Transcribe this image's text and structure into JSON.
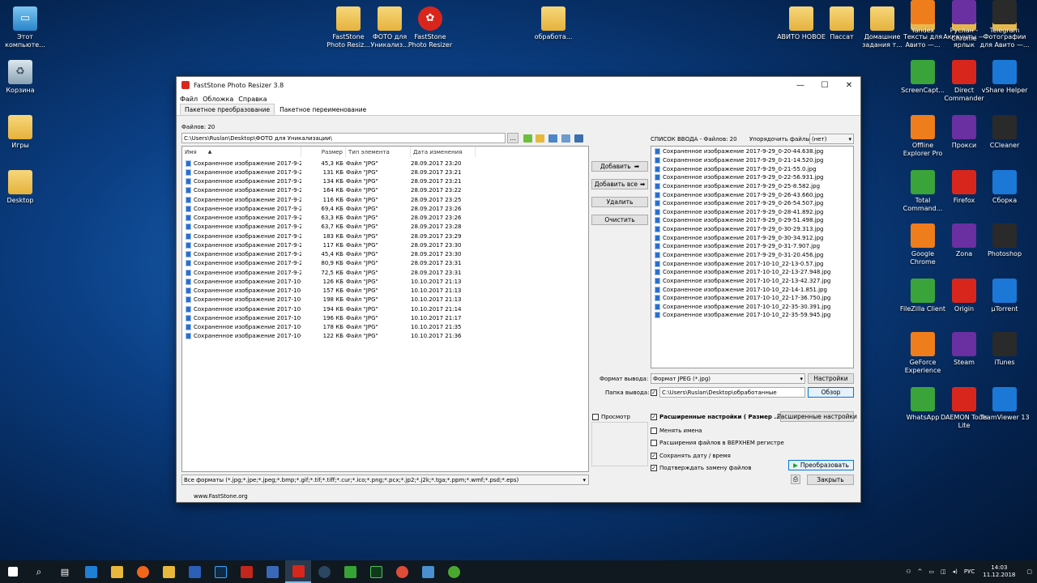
{
  "desktop": {
    "left_icons": [
      {
        "label": "Этот компьюте...",
        "icon": "computer-icon"
      },
      {
        "label": "Корзина",
        "icon": "recycle-bin-icon"
      },
      {
        "label": "Игры",
        "icon": "folder-icon"
      },
      {
        "label": "Desktop",
        "icon": "folder-icon"
      }
    ],
    "top_icons": [
      {
        "label": "FastStone Photo Resiz...",
        "icon": "folder-icon"
      },
      {
        "label": "ФОТО для Уникализ...",
        "icon": "folder-icon"
      },
      {
        "label": "FastStone Photo Resizer",
        "icon": "faststone-icon"
      },
      {
        "label": "обработа...",
        "icon": "folder-icon"
      }
    ],
    "right_icons": [
      {
        "label": "АВИТО НОВОЕ",
        "icon": "folder-icon"
      },
      {
        "label": "Пассат",
        "icon": "folder-icon"
      },
      {
        "label": "Домашние задания т...",
        "icon": "folder-icon"
      },
      {
        "label": "Тексты для Авито —...",
        "icon": "folder-icon"
      },
      {
        "label": "Аккаунты — ярлык",
        "icon": "folder-icon"
      },
      {
        "label": "Фотографии для Авито —...",
        "icon": "folder-icon"
      },
      {
        "label": "ScreenCapt...",
        "icon": "screencapture-icon"
      },
      {
        "label": "Direct Commander",
        "icon": "direct-commander-icon"
      },
      {
        "label": "vShare Helper",
        "icon": "vshare-icon"
      },
      {
        "label": "Offline Explorer Pro",
        "icon": "offline-explorer-icon"
      },
      {
        "label": "Прокси",
        "icon": "proxy-icon"
      },
      {
        "label": "CCleaner",
        "icon": "ccleaner-icon"
      },
      {
        "label": "Total Command...",
        "icon": "total-commander-icon"
      },
      {
        "label": "Firefox",
        "icon": "firefox-icon"
      },
      {
        "label": "Сборка",
        "icon": "winrar-icon"
      },
      {
        "label": "Google Chrome",
        "icon": "chrome-icon"
      },
      {
        "label": "Zona",
        "icon": "zona-icon"
      },
      {
        "label": "Photoshop",
        "icon": "photoshop-icon"
      },
      {
        "label": "FileZilla Client",
        "icon": "filezilla-icon"
      },
      {
        "label": "Origin",
        "icon": "origin-icon"
      },
      {
        "label": "µTorrent",
        "icon": "utorrent-icon"
      },
      {
        "label": "GeForce Experience",
        "icon": "geforce-icon"
      },
      {
        "label": "Steam",
        "icon": "steam-icon"
      },
      {
        "label": "iTunes",
        "icon": "itunes-icon"
      },
      {
        "label": "WhatsApp",
        "icon": "whatsapp-icon"
      },
      {
        "label": "DAEMON Tools Lite",
        "icon": "daemon-tools-icon"
      },
      {
        "label": "TeamViewer 13",
        "icon": "teamviewer-icon"
      },
      {
        "label": "Yandex",
        "icon": "yandex-icon"
      },
      {
        "label": "Руслан - Chrome",
        "icon": "chrome-icon"
      },
      {
        "label": "Telegram",
        "icon": "telegram-icon"
      }
    ]
  },
  "window": {
    "title": "FastStone Photo Resizer 3.8",
    "controls": {
      "minimize": "—",
      "maximize": "☐",
      "close": "✕"
    },
    "menu": [
      "Файл",
      "Обложка",
      "Справка"
    ],
    "tabs": [
      {
        "label": "Пакетное преобразование",
        "active": true
      },
      {
        "label": "Пакетное переименование",
        "active": false
      }
    ],
    "files_count": "Файлов: 20",
    "path": "C:\\Users\\Ruslan\\Desktop\\ФОТО для Уникализации\\",
    "path_browse": "...",
    "columns": {
      "name": "Имя",
      "size": "Размер",
      "type": "Тип элемента",
      "date": "Дата изменения"
    },
    "files": [
      {
        "name": "Сохраненное изображение 2017-9-2...",
        "size": "45,3 КБ",
        "type": "Файл \"JPG\"",
        "date": "28.09.2017 23:20"
      },
      {
        "name": "Сохраненное изображение 2017-9-2...",
        "size": "131 КБ",
        "type": "Файл \"JPG\"",
        "date": "28.09.2017 23:21"
      },
      {
        "name": "Сохраненное изображение 2017-9-2...",
        "size": "134 КБ",
        "type": "Файл \"JPG\"",
        "date": "28.09.2017 23:21"
      },
      {
        "name": "Сохраненное изображение 2017-9-2...",
        "size": "164 КБ",
        "type": "Файл \"JPG\"",
        "date": "28.09.2017 23:22"
      },
      {
        "name": "Сохраненное изображение 2017-9-2...",
        "size": "116 КБ",
        "type": "Файл \"JPG\"",
        "date": "28.09.2017 23:25"
      },
      {
        "name": "Сохраненное изображение 2017-9-2...",
        "size": "69,4 КБ",
        "type": "Файл \"JPG\"",
        "date": "28.09.2017 23:26"
      },
      {
        "name": "Сохраненное изображение 2017-9-2...",
        "size": "63,3 КБ",
        "type": "Файл \"JPG\"",
        "date": "28.09.2017 23:26"
      },
      {
        "name": "Сохраненное изображение 2017-9-2...",
        "size": "63,7 КБ",
        "type": "Файл \"JPG\"",
        "date": "28.09.2017 23:28"
      },
      {
        "name": "Сохраненное изображение 2017-9-2...",
        "size": "183 КБ",
        "type": "Файл \"JPG\"",
        "date": "28.09.2017 23:29"
      },
      {
        "name": "Сохраненное изображение 2017-9-2...",
        "size": "117 КБ",
        "type": "Файл \"JPG\"",
        "date": "28.09.2017 23:30"
      },
      {
        "name": "Сохраненное изображение 2017-9-2...",
        "size": "45,4 КБ",
        "type": "Файл \"JPG\"",
        "date": "28.09.2017 23:30"
      },
      {
        "name": "Сохраненное изображение 2017-9-2...",
        "size": "80,9 КБ",
        "type": "Файл \"JPG\"",
        "date": "28.09.2017 23:31"
      },
      {
        "name": "Сохраненное изображение 2017-9-2...",
        "size": "72,5 КБ",
        "type": "Файл \"JPG\"",
        "date": "28.09.2017 23:31"
      },
      {
        "name": "Сохраненное изображение 2017-10-...",
        "size": "126 КБ",
        "type": "Файл \"JPG\"",
        "date": "10.10.2017 21:13"
      },
      {
        "name": "Сохраненное изображение 2017-10-...",
        "size": "157 КБ",
        "type": "Файл \"JPG\"",
        "date": "10.10.2017 21:13"
      },
      {
        "name": "Сохраненное изображение 2017-10-...",
        "size": "198 КБ",
        "type": "Файл \"JPG\"",
        "date": "10.10.2017 21:13"
      },
      {
        "name": "Сохраненное изображение 2017-10-...",
        "size": "194 КБ",
        "type": "Файл \"JPG\"",
        "date": "10.10.2017 21:14"
      },
      {
        "name": "Сохраненное изображение 2017-10-...",
        "size": "196 КБ",
        "type": "Файл \"JPG\"",
        "date": "10.10.2017 21:17"
      },
      {
        "name": "Сохраненное изображение 2017-10-...",
        "size": "178 КБ",
        "type": "Файл \"JPG\"",
        "date": "10.10.2017 21:35"
      },
      {
        "name": "Сохраненное изображение 2017-10-...",
        "size": "122 КБ",
        "type": "Файл \"JPG\"",
        "date": "10.10.2017 21:36"
      }
    ],
    "formats_filter": "Все форматы (*.jpg;*.jpe;*.jpeg;*.bmp;*.gif;*.tif;*.tiff;*.cur;*.ico;*.png;*.pcx;*.jp2;*.j2k;*.tga;*.ppm;*.wmf;*.psd;*.eps)",
    "buttons": {
      "add": "Добавить",
      "add_all": "Добавить все",
      "remove": "Удалить",
      "clear": "Очистить",
      "settings": "Настройки",
      "browse": "Обзор",
      "advanced": "Расширенные настройки",
      "convert": "Преобразовать",
      "close": "Закрыть"
    },
    "input_list_title": "СПИСОК ВВОДА  - Файлов: 20",
    "sort_label": "Упорядочить файлы:",
    "sort_value": "(нет)",
    "input_files": [
      "Сохраненное изображение 2017-9-29_0-20-44.638.jpg",
      "Сохраненное изображение 2017-9-29_0-21-14.520.jpg",
      "Сохраненное изображение 2017-9-29_0-21-55.0.jpg",
      "Сохраненное изображение 2017-9-29_0-22-56.931.jpg",
      "Сохраненное изображение 2017-9-29_0-25-8.582.jpg",
      "Сохраненное изображение 2017-9-29_0-26-43.660.jpg",
      "Сохраненное изображение 2017-9-29_0-26-54.507.jpg",
      "Сохраненное изображение 2017-9-29_0-28-41.892.jpg",
      "Сохраненное изображение 2017-9-29_0-29-51.498.jpg",
      "Сохраненное изображение 2017-9-29_0-30-29.313.jpg",
      "Сохраненное изображение 2017-9-29_0-30-34.912.jpg",
      "Сохраненное изображение 2017-9-29_0-31-7.907.jpg",
      "Сохраненное изображение 2017-9-29_0-31-20.456.jpg",
      "Сохраненное изображение 2017-10-10_22-13-0.57.jpg",
      "Сохраненное изображение 2017-10-10_22-13-27.948.jpg",
      "Сохраненное изображение 2017-10-10_22-13-42.327.jpg",
      "Сохраненное изображение 2017-10-10_22-14-1.851.jpg",
      "Сохраненное изображение 2017-10-10_22-17-36.750.jpg",
      "Сохраненное изображение 2017-10-10_22-35-30.391.jpg",
      "Сохраненное изображение 2017-10-10_22-35-59.945.jpg"
    ],
    "output_format_label": "Формат вывода:",
    "output_format_value": "Формат JPEG (*.jpg)",
    "output_folder_label": "Папка вывода:",
    "output_folder_value": "C:\\Users\\Ruslan\\Desktop\\обработанные",
    "preview_label": "Просмотр",
    "advanced_checkbox_label": "Расширенные настройки ( Размер ... )",
    "options": [
      {
        "label": "Менять имена",
        "checked": false
      },
      {
        "label": "Расширения файлов в ВЕРХНЕМ регистре",
        "checked": false
      },
      {
        "label": "Сохранять дату / время",
        "checked": true
      },
      {
        "label": "Подтверждать замену файлов",
        "checked": true
      }
    ],
    "website": "www.FastStone.org"
  },
  "taskbar": {
    "language": "РУС",
    "time": "14:03",
    "date": "11.12.2018"
  },
  "colors": {
    "accent": "#0078d7",
    "file_icon": "#2a6fd0",
    "convert_arrow": "#1aa01a"
  }
}
